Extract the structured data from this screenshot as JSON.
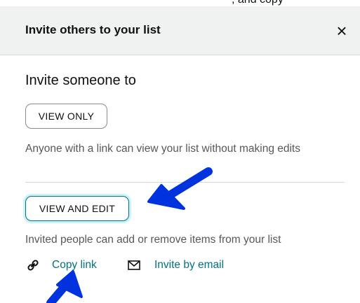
{
  "top_fragment": ", and copy",
  "dialog": {
    "title": "Invite others to your list",
    "close_label": "×"
  },
  "invite": {
    "heading": "Invite someone to",
    "view_only": {
      "label": "VIEW ONLY",
      "description": "Anyone with a link can view your list without making edits"
    },
    "view_and_edit": {
      "label": "VIEW AND EDIT",
      "description": "Invited people can add or remove items from your list"
    }
  },
  "actions": {
    "copy_link": {
      "label": "Copy link",
      "icon": "link-icon"
    },
    "invite_email": {
      "label": "Invite by email",
      "icon": "envelope-icon"
    }
  },
  "annotations": {
    "arrow_color": "#0033dd"
  },
  "colors": {
    "header_bg": "#f0f2f2",
    "link": "#007185",
    "focus_ring": "#c8f3fa",
    "muted_text": "#565959"
  }
}
